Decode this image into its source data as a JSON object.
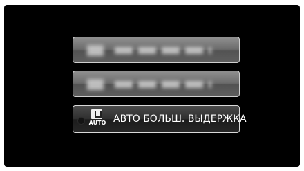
{
  "menu": {
    "items": [
      {
        "state": "blurred"
      },
      {
        "state": "blurred"
      },
      {
        "state": "selected",
        "icon": "slow-shutter-auto-icon",
        "icon_caption": "AUTO",
        "label": "АВТО БОЛЬШ. ВЫДЕРЖКА"
      }
    ]
  }
}
